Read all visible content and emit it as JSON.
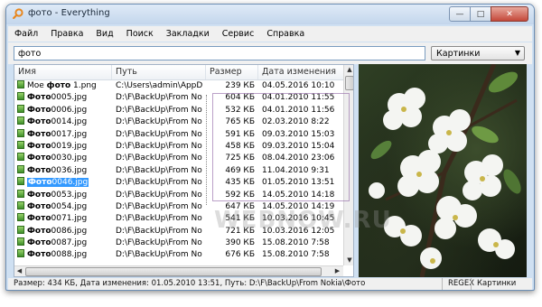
{
  "window": {
    "title": "фото - Everything"
  },
  "menu": [
    "Файл",
    "Правка",
    "Вид",
    "Поиск",
    "Закладки",
    "Сервис",
    "Справка"
  ],
  "search": {
    "value": "фото",
    "filter": "Картинки"
  },
  "columns": {
    "name": "Имя",
    "path": "Путь",
    "size": "Размер",
    "date": "Дата изменения"
  },
  "files": [
    {
      "pre": "Мое ",
      "bold": "фото",
      "post": " 1.png",
      "path": "C:\\Users\\admin\\AppD...",
      "size": "239 КБ",
      "date": "04.05.2016 10:10"
    },
    {
      "pre": "",
      "bold": "Фото",
      "post": "0005.jpg",
      "path": "D:\\F\\BackUp\\From No...",
      "size": "604 КБ",
      "date": "04.01.2010 11:55"
    },
    {
      "pre": "",
      "bold": "Фото",
      "post": "0006.jpg",
      "path": "D:\\F\\BackUp\\From No...",
      "size": "532 КБ",
      "date": "04.01.2010 11:56"
    },
    {
      "pre": "",
      "bold": "Фото",
      "post": "0014.jpg",
      "path": "D:\\F\\BackUp\\From No...",
      "size": "765 КБ",
      "date": "02.03.2010 8:22"
    },
    {
      "pre": "",
      "bold": "Фото",
      "post": "0017.jpg",
      "path": "D:\\F\\BackUp\\From No...",
      "size": "591 КБ",
      "date": "09.03.2010 15:03"
    },
    {
      "pre": "",
      "bold": "Фото",
      "post": "0019.jpg",
      "path": "D:\\F\\BackUp\\From No...",
      "size": "458 КБ",
      "date": "09.03.2010 15:04"
    },
    {
      "pre": "",
      "bold": "Фото",
      "post": "0030.jpg",
      "path": "D:\\F\\BackUp\\From No...",
      "size": "725 КБ",
      "date": "08.04.2010 23:06"
    },
    {
      "pre": "",
      "bold": "Фото",
      "post": "0036.jpg",
      "path": "D:\\F\\BackUp\\From No...",
      "size": "469 КБ",
      "date": "11.04.2010 9:31"
    },
    {
      "pre": "",
      "bold": "Фото",
      "post": "0046.jpg",
      "path": "D:\\F\\BackUp\\From No...",
      "size": "435 КБ",
      "date": "01.05.2010 13:51",
      "selected": true
    },
    {
      "pre": "",
      "bold": "Фото",
      "post": "0053.jpg",
      "path": "D:\\F\\BackUp\\From No...",
      "size": "592 КБ",
      "date": "14.05.2010 14:18"
    },
    {
      "pre": "",
      "bold": "Фото",
      "post": "0054.jpg",
      "path": "D:\\F\\BackUp\\From No...",
      "size": "647 КБ",
      "date": "14.05.2010 14:19"
    },
    {
      "pre": "",
      "bold": "Фото",
      "post": "0071.jpg",
      "path": "D:\\F\\BackUp\\From No...",
      "size": "541 КБ",
      "date": "10.03.2016 10:45"
    },
    {
      "pre": "",
      "bold": "Фото",
      "post": "0086.jpg",
      "path": "D:\\F\\BackUp\\From No...",
      "size": "721 КБ",
      "date": "10.03.2016 12:05"
    },
    {
      "pre": "",
      "bold": "Фото",
      "post": "0087.jpg",
      "path": "D:\\F\\BackUp\\From No...",
      "size": "390 КБ",
      "date": "15.08.2010 7:58"
    },
    {
      "pre": "",
      "bold": "Фото",
      "post": "0088.jpg",
      "path": "D:\\F\\BackUp\\From No...",
      "size": "676 КБ",
      "date": "15.08.2010 7:58"
    }
  ],
  "status": {
    "text": "Размер: 434 КБ, Дата изменения: 01.05.2010 13:51, Путь: D:\\F\\BackUp\\From Nokia\\Фото",
    "regex": "REGEX",
    "filter": "Картинки"
  },
  "watermark": "WEBNOW.RU"
}
